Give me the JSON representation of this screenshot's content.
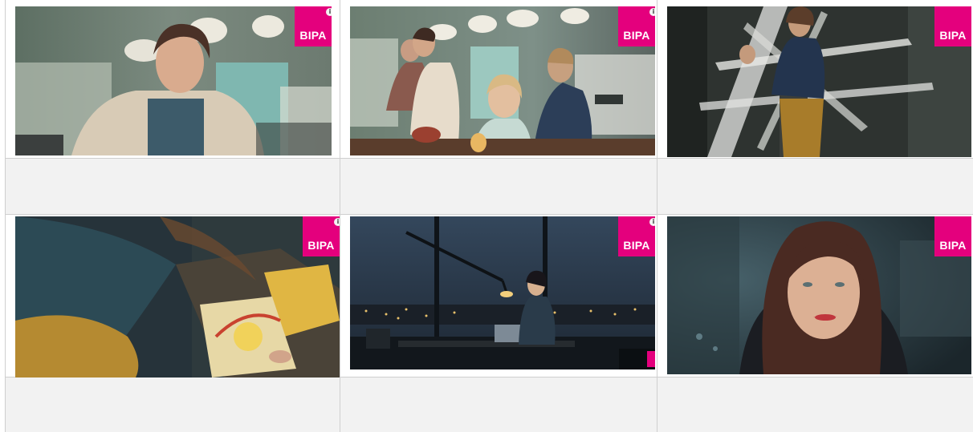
{
  "brand": {
    "label": "BIPA",
    "color": "#e4007d",
    "info_icon": "info-icon",
    "info_glyph": "i"
  },
  "frames": [
    {
      "scene": "kitchen-woman-surprised"
    },
    {
      "scene": "kitchen-family-birthday"
    },
    {
      "scene": "streamer-decorated-room"
    },
    {
      "scene": "woman-drawing-posters"
    },
    {
      "scene": "office-night-desk"
    },
    {
      "scene": "woman-smiling-closeup"
    }
  ]
}
